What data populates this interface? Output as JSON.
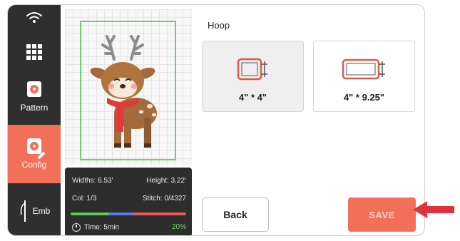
{
  "sidebar": {
    "items": [
      {
        "label": "Pattern",
        "icon": "pattern-icon"
      },
      {
        "label": "Config",
        "icon": "config-icon",
        "active": true
      },
      {
        "label": "Emb",
        "icon": "needle-icon"
      }
    ]
  },
  "info": {
    "width": "Widths: 6.53'",
    "height": "Height: 3.22'",
    "col": "Col: 1/3",
    "stitch": "Stitch: 0/4327",
    "time": "Time: 5min",
    "progress": "20%"
  },
  "hoop": {
    "title": "Hoop",
    "options": [
      {
        "label": "4\" * 4\"",
        "selected": true
      },
      {
        "label": "4\" * 9.25\"",
        "selected": false
      }
    ]
  },
  "buttons": {
    "back": "Back",
    "save": "SAVE"
  },
  "colors": {
    "accent": "#f2705a",
    "sidebar": "#2f2f2f",
    "hoop_outline": "#6fcf6f"
  }
}
